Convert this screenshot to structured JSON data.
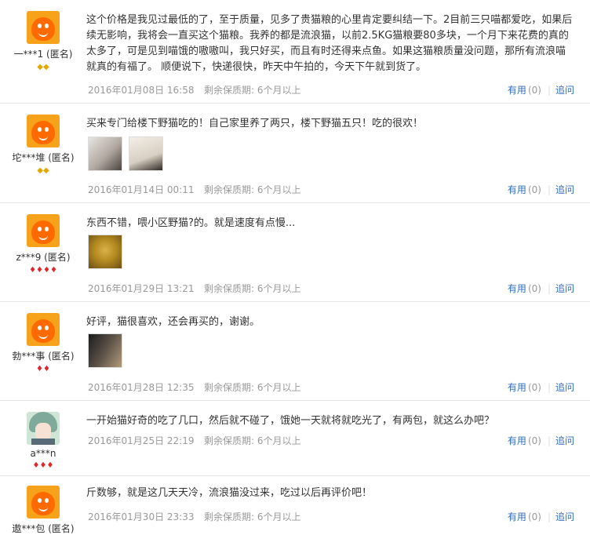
{
  "labels": {
    "useful": "有用",
    "ask": "追问",
    "shelf_prefix": "剩余保质期:"
  },
  "reviews": [
    {
      "user": "一***1 (匿名)",
      "avatar": "default-orange-avatar",
      "badge_type": "gold",
      "badges": "◆◆",
      "content": "这个价格是我见过最低的了，至于质量，见多了贵猫粮的心里肯定要纠结一下。2目前三只喵都爱吃，如果后续无影响，我将会一直买这个猫粮。我养的都是流浪猫，以前2.5KG猫粮要80多块，一个月下来花费的真的太多了，可是见到喵饿的嗷嗷叫，我只好买，而且有时还得来点鱼。如果这猫粮质量没问题，那所有流浪喵就真的有福了。 顺便说下，快递很快，昨天中午拍的，今天下午就到货了。",
      "date": "2016年01月08日 16:58",
      "shelf": "6个月以上",
      "useful_count": "(0)"
    },
    {
      "user": "坨***堆 (匿名)",
      "avatar": "default-orange-avatar",
      "badge_type": "gold",
      "badges": "◆◆",
      "content": "买来专门给楼下野猫吃的！自己家里养了两只，楼下野猫五只！吃的很欢！",
      "date": "2016年01月14日 00:11",
      "shelf": "6个月以上",
      "useful_count": "(0)"
    },
    {
      "user": "z***9 (匿名)",
      "avatar": "default-orange-avatar",
      "badge_type": "red",
      "badges": "♦♦♦♦",
      "content": "东西不错，喂小区野猫?的。就是速度有点慢...",
      "date": "2016年01月29日 13:21",
      "shelf": "6个月以上",
      "useful_count": "(0)"
    },
    {
      "user": "勃***事 (匿名)",
      "avatar": "default-orange-avatar",
      "badge_type": "red",
      "badges": "♦♦",
      "content": "好评，猫很喜欢，还会再买的，谢谢。",
      "date": "2016年01月28日 12:35",
      "shelf": "6个月以上",
      "useful_count": "(0)"
    },
    {
      "user": "a***n",
      "avatar": "anime-girl-avatar",
      "badge_type": "red",
      "badges": "♦♦♦",
      "content": "一开始猫好奇的吃了几口，然后就不碰了，饿她一天就将就吃光了，有两包，就这么办吧？",
      "date": "2016年01月25日 22:19",
      "shelf": "6个月以上",
      "useful_count": "(0)"
    },
    {
      "user": "遨***包 (匿名)",
      "avatar": "default-orange-avatar",
      "badge_type": "none",
      "badges": "",
      "content": "斤数够，就是这几天天冷，流浪猫没过来，吃过以后再评价吧！",
      "date": "2016年01月30日 23:33",
      "shelf": "6个月以上",
      "useful_count": "(0)"
    }
  ]
}
